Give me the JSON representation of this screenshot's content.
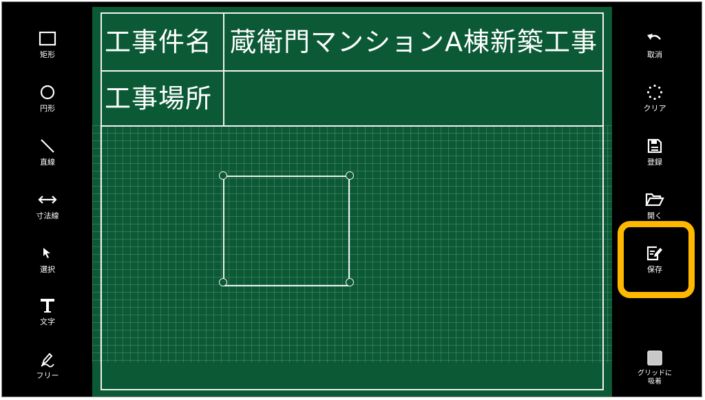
{
  "left_toolbar": {
    "items": [
      {
        "label": "矩形",
        "icon": "rectangle-icon"
      },
      {
        "label": "円形",
        "icon": "circle-icon"
      },
      {
        "label": "直線",
        "icon": "line-icon"
      },
      {
        "label": "寸法線",
        "icon": "dimension-line-icon"
      },
      {
        "label": "選択",
        "icon": "cursor-arrow-icon"
      },
      {
        "label": "文字",
        "icon": "text-t-icon"
      },
      {
        "label": "フリー",
        "icon": "pen-free-draw-icon"
      }
    ]
  },
  "right_toolbar": {
    "items": [
      {
        "label": "取消",
        "icon": "undo-icon"
      },
      {
        "label": "クリア",
        "icon": "clear-spinner-icon"
      },
      {
        "label": "登録",
        "icon": "save-disk-icon"
      },
      {
        "label": "開く",
        "icon": "folder-open-icon"
      },
      {
        "label": "保存",
        "icon": "edit-document-icon"
      },
      {
        "label": "グリッドに\n吸着",
        "icon": "checkbox-icon"
      }
    ],
    "highlighted": "保存",
    "highlight_color": "#ffb800"
  },
  "board": {
    "background_color": "#0b5a35",
    "rows": [
      {
        "label": "工事件名",
        "value": "蔵衛門マンションA棟新築工事"
      },
      {
        "label": "工事場所",
        "value": ""
      }
    ],
    "grid_snap_checked": false
  }
}
